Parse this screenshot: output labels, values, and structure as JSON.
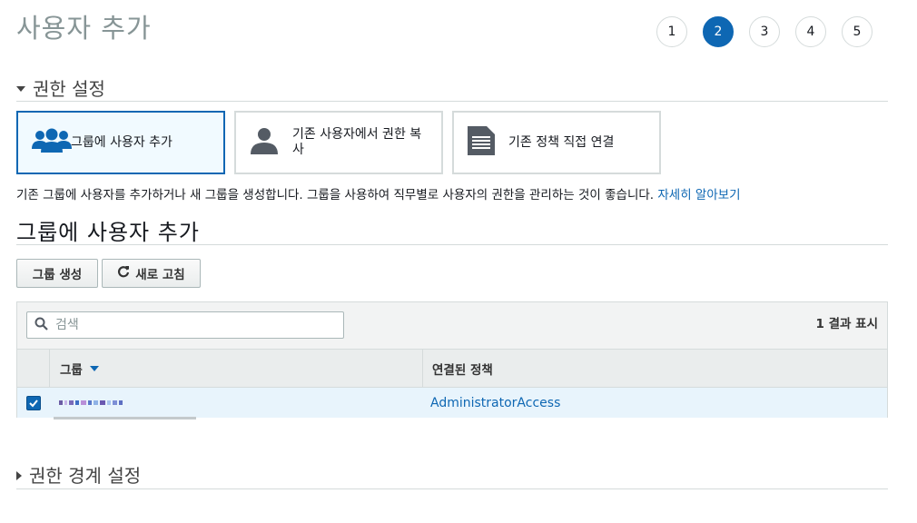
{
  "page": {
    "title": "사용자 추가"
  },
  "steps": [
    "1",
    "2",
    "3",
    "4",
    "5"
  ],
  "active_step": "2",
  "permissions_section": {
    "title": "권한 설정"
  },
  "options": [
    {
      "label": "그룹에 사용자 추가",
      "icon": "users-group-icon",
      "selected": true
    },
    {
      "label_line1": "기존 사용자에서 권한 복",
      "label_line2": "사",
      "icon": "user-icon",
      "selected": false
    },
    {
      "label": "기존 정책 직접 연결",
      "icon": "policy-document-icon",
      "selected": false
    }
  ],
  "description": {
    "text": "기존 그룹에 사용자를 추가하거나 새 그룹을 생성합니다. 그룹을 사용하여 직무별로 사용자의 권한을 관리하는 것이 좋습니다. ",
    "link": "자세히 알아보기"
  },
  "group_section": {
    "title": "그룹에 사용자 추가"
  },
  "buttons": {
    "create_group": "그룹 생성",
    "refresh": "새로 고침"
  },
  "table": {
    "search_placeholder": "검색",
    "result_count": "1 결과 표시",
    "columns": {
      "group": "그룹",
      "policies": "연결된 정책"
    },
    "rows": [
      {
        "checked": true,
        "group": "",
        "policy": "AdministratorAccess"
      }
    ]
  },
  "boundary_section": {
    "title": "권한 경계 설정"
  },
  "colors": {
    "accent": "#0e67b3",
    "selected_bg": "#f1faff",
    "row_selected_bg": "#e8f4fc"
  }
}
